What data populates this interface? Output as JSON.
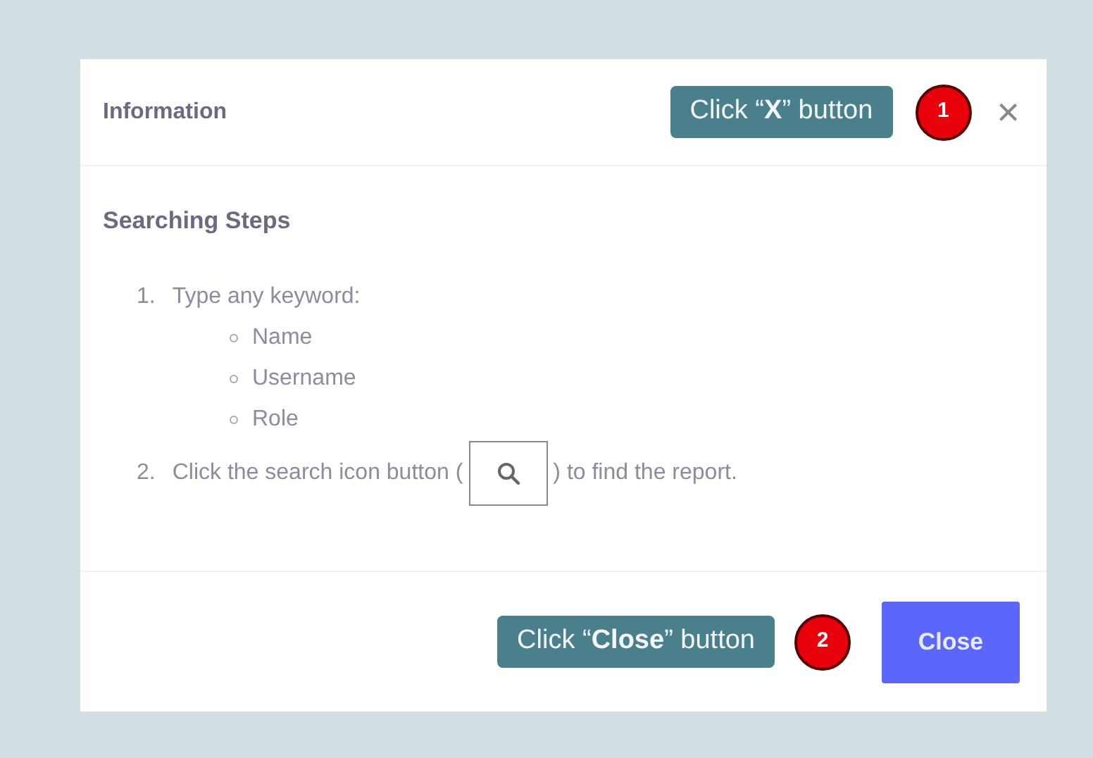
{
  "dialog": {
    "title": "Information",
    "header_callout": {
      "text": "Click “**X**” button",
      "badge": "1"
    },
    "close_icon": "×",
    "section_title": "Searching Steps",
    "steps": [
      {
        "number": "1.",
        "kind": "text",
        "text": "Type any keyword:",
        "children": [
          {
            "text": "Name"
          },
          {
            "text": "Username"
          },
          {
            "text": "Role"
          }
        ]
      },
      {
        "number": "2.",
        "kind": "search",
        "text_before": "Click the search icon button (",
        "text_after": ") to find the report."
      }
    ],
    "footer_callout": {
      "text": "Click “**Close**” button",
      "badge": "2"
    },
    "button": "Close"
  }
}
